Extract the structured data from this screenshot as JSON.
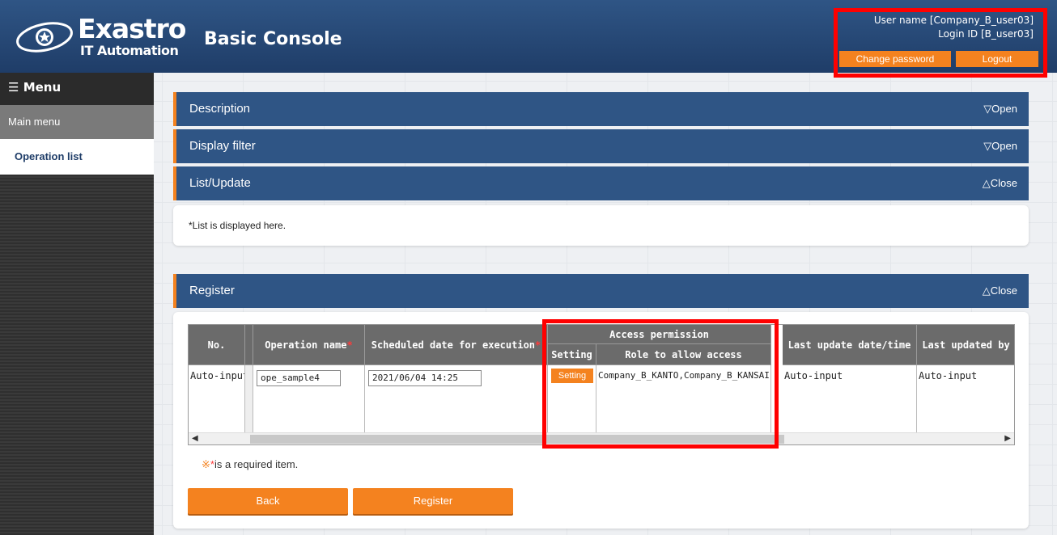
{
  "header": {
    "logo_name": "Exastro",
    "logo_sub": "IT Automation",
    "console_title": "Basic Console",
    "user_name": "User name [Company_B_user03]",
    "login_id": "Login ID [B_user03]",
    "change_password": "Change password",
    "logout": "Logout"
  },
  "sidebar": {
    "menu_title": "Menu",
    "menu_icon": "hamburger-icon",
    "items": [
      {
        "label": "Main menu"
      },
      {
        "label": "Operation list"
      }
    ]
  },
  "sections": {
    "description": {
      "label": "Description",
      "toggle": "▽Open"
    },
    "filter": {
      "label": "Display filter",
      "toggle": "▽Open"
    },
    "list": {
      "label": "List/Update",
      "toggle": "△Close",
      "body": "*List is displayed here."
    },
    "register": {
      "label": "Register",
      "toggle": "△Close"
    }
  },
  "table": {
    "headers": {
      "no": "No.",
      "operation_name": "Operation name",
      "scheduled": "Scheduled date for execution",
      "access_permission": "Access permission",
      "setting": "Setting",
      "role": "Role to allow access",
      "last_update": "Last update date/time",
      "last_updated_by": "Last updated by",
      "required_mark": "*"
    },
    "row": {
      "no": "Auto-input",
      "operation_name": "ope_sample4",
      "scheduled": "2021/06/04 14:25",
      "setting_btn": "Setting",
      "role": "Company_B_KANTO,Company_B_KANSAI",
      "last_update": "Auto-input",
      "last_updated_by": "Auto-input"
    }
  },
  "note": {
    "mark": "※",
    "req": "*",
    "text": "is a required item."
  },
  "buttons": {
    "back": "Back",
    "register": "Register"
  },
  "colors": {
    "accent": "#f4821f",
    "bar": "#2f5585",
    "highlight": "#ff0000"
  }
}
